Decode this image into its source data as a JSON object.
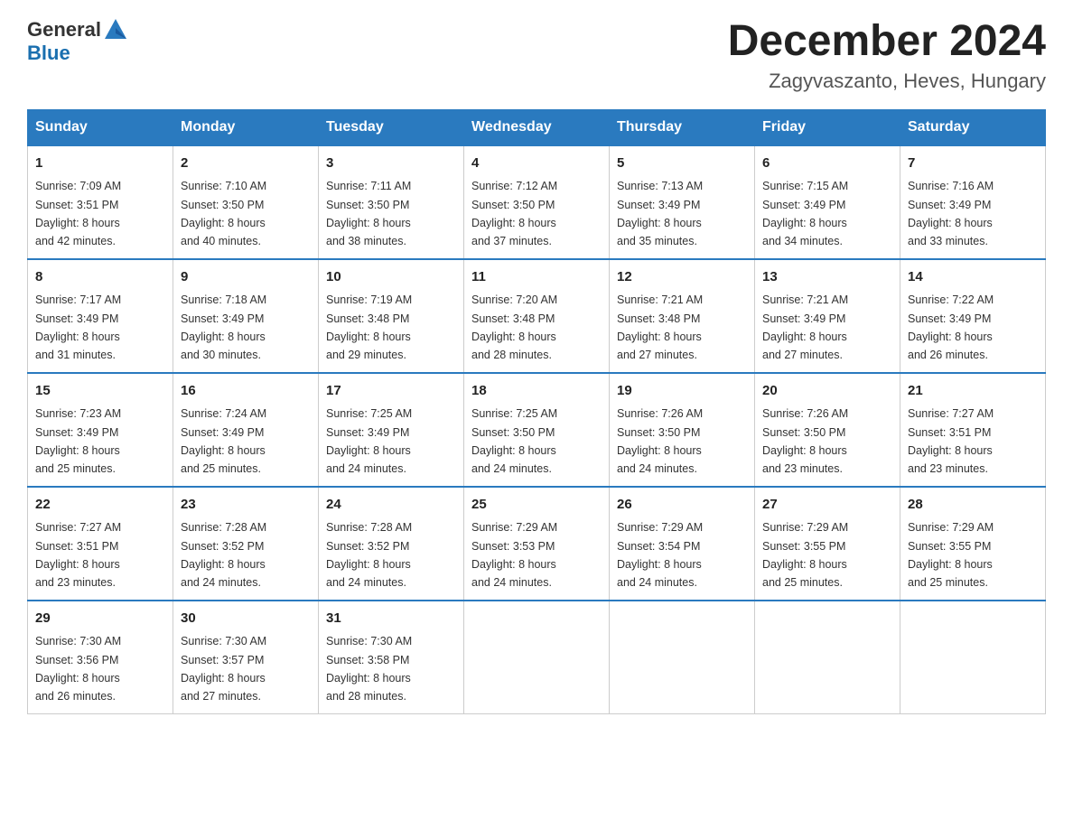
{
  "header": {
    "logo_general": "General",
    "logo_blue": "Blue",
    "month_title": "December 2024",
    "location": "Zagyvaszanto, Heves, Hungary"
  },
  "days_of_week": [
    "Sunday",
    "Monday",
    "Tuesday",
    "Wednesday",
    "Thursday",
    "Friday",
    "Saturday"
  ],
  "weeks": [
    [
      {
        "day": "1",
        "sunrise": "7:09 AM",
        "sunset": "3:51 PM",
        "daylight": "8 hours and 42 minutes."
      },
      {
        "day": "2",
        "sunrise": "7:10 AM",
        "sunset": "3:50 PM",
        "daylight": "8 hours and 40 minutes."
      },
      {
        "day": "3",
        "sunrise": "7:11 AM",
        "sunset": "3:50 PM",
        "daylight": "8 hours and 38 minutes."
      },
      {
        "day": "4",
        "sunrise": "7:12 AM",
        "sunset": "3:50 PM",
        "daylight": "8 hours and 37 minutes."
      },
      {
        "day": "5",
        "sunrise": "7:13 AM",
        "sunset": "3:49 PM",
        "daylight": "8 hours and 35 minutes."
      },
      {
        "day": "6",
        "sunrise": "7:15 AM",
        "sunset": "3:49 PM",
        "daylight": "8 hours and 34 minutes."
      },
      {
        "day": "7",
        "sunrise": "7:16 AM",
        "sunset": "3:49 PM",
        "daylight": "8 hours and 33 minutes."
      }
    ],
    [
      {
        "day": "8",
        "sunrise": "7:17 AM",
        "sunset": "3:49 PM",
        "daylight": "8 hours and 31 minutes."
      },
      {
        "day": "9",
        "sunrise": "7:18 AM",
        "sunset": "3:49 PM",
        "daylight": "8 hours and 30 minutes."
      },
      {
        "day": "10",
        "sunrise": "7:19 AM",
        "sunset": "3:48 PM",
        "daylight": "8 hours and 29 minutes."
      },
      {
        "day": "11",
        "sunrise": "7:20 AM",
        "sunset": "3:48 PM",
        "daylight": "8 hours and 28 minutes."
      },
      {
        "day": "12",
        "sunrise": "7:21 AM",
        "sunset": "3:48 PM",
        "daylight": "8 hours and 27 minutes."
      },
      {
        "day": "13",
        "sunrise": "7:21 AM",
        "sunset": "3:49 PM",
        "daylight": "8 hours and 27 minutes."
      },
      {
        "day": "14",
        "sunrise": "7:22 AM",
        "sunset": "3:49 PM",
        "daylight": "8 hours and 26 minutes."
      }
    ],
    [
      {
        "day": "15",
        "sunrise": "7:23 AM",
        "sunset": "3:49 PM",
        "daylight": "8 hours and 25 minutes."
      },
      {
        "day": "16",
        "sunrise": "7:24 AM",
        "sunset": "3:49 PM",
        "daylight": "8 hours and 25 minutes."
      },
      {
        "day": "17",
        "sunrise": "7:25 AM",
        "sunset": "3:49 PM",
        "daylight": "8 hours and 24 minutes."
      },
      {
        "day": "18",
        "sunrise": "7:25 AM",
        "sunset": "3:50 PM",
        "daylight": "8 hours and 24 minutes."
      },
      {
        "day": "19",
        "sunrise": "7:26 AM",
        "sunset": "3:50 PM",
        "daylight": "8 hours and 24 minutes."
      },
      {
        "day": "20",
        "sunrise": "7:26 AM",
        "sunset": "3:50 PM",
        "daylight": "8 hours and 23 minutes."
      },
      {
        "day": "21",
        "sunrise": "7:27 AM",
        "sunset": "3:51 PM",
        "daylight": "8 hours and 23 minutes."
      }
    ],
    [
      {
        "day": "22",
        "sunrise": "7:27 AM",
        "sunset": "3:51 PM",
        "daylight": "8 hours and 23 minutes."
      },
      {
        "day": "23",
        "sunrise": "7:28 AM",
        "sunset": "3:52 PM",
        "daylight": "8 hours and 24 minutes."
      },
      {
        "day": "24",
        "sunrise": "7:28 AM",
        "sunset": "3:52 PM",
        "daylight": "8 hours and 24 minutes."
      },
      {
        "day": "25",
        "sunrise": "7:29 AM",
        "sunset": "3:53 PM",
        "daylight": "8 hours and 24 minutes."
      },
      {
        "day": "26",
        "sunrise": "7:29 AM",
        "sunset": "3:54 PM",
        "daylight": "8 hours and 24 minutes."
      },
      {
        "day": "27",
        "sunrise": "7:29 AM",
        "sunset": "3:55 PM",
        "daylight": "8 hours and 25 minutes."
      },
      {
        "day": "28",
        "sunrise": "7:29 AM",
        "sunset": "3:55 PM",
        "daylight": "8 hours and 25 minutes."
      }
    ],
    [
      {
        "day": "29",
        "sunrise": "7:30 AM",
        "sunset": "3:56 PM",
        "daylight": "8 hours and 26 minutes."
      },
      {
        "day": "30",
        "sunrise": "7:30 AM",
        "sunset": "3:57 PM",
        "daylight": "8 hours and 27 minutes."
      },
      {
        "day": "31",
        "sunrise": "7:30 AM",
        "sunset": "3:58 PM",
        "daylight": "8 hours and 28 minutes."
      },
      null,
      null,
      null,
      null
    ]
  ],
  "labels": {
    "sunrise": "Sunrise:",
    "sunset": "Sunset:",
    "daylight": "Daylight:"
  }
}
